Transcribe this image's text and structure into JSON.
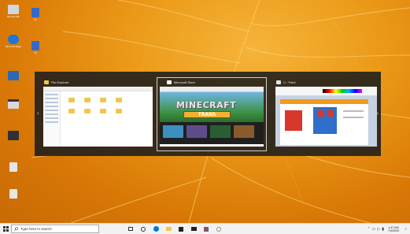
{
  "desktop": {
    "icons": [
      {
        "label": "Recycle Bin",
        "color": "#cfd7e3"
      },
      {
        "label": "Microsoft Edge",
        "color": "#1e77d3"
      },
      {
        "label": "",
        "color": "#2c69b5"
      },
      {
        "label": "",
        "color": "#d9d9d9"
      },
      {
        "label": "",
        "color": "#2f3138"
      },
      {
        "label": "",
        "color": "#e7e7e7"
      },
      {
        "label": "",
        "color": "#e7e7e7"
      }
    ],
    "icons_col2": [
      {
        "label": "W",
        "color": "#3569c8"
      },
      {
        "label": "W",
        "color": "#3569c8"
      }
    ]
  },
  "switcher": {
    "windows": [
      {
        "title": "File Explorer",
        "icon": "folder-icon",
        "selected": false
      },
      {
        "title": "Microsoft Store",
        "icon": "store-icon",
        "selected": true
      },
      {
        "title": "U - Paint",
        "icon": "paint-icon",
        "selected": false
      }
    ],
    "store": {
      "logo": "MINECRAFT",
      "subtitle": "TRANS"
    }
  },
  "taskbar": {
    "search_placeholder": "Type here to search",
    "clock_time": "1:47 AM",
    "clock_date": "7/4/2020",
    "pinned": [
      "task-view-icon",
      "cortana-icon",
      "edge-icon",
      "file-explorer-icon",
      "store-icon",
      "mail-icon",
      "paint-icon",
      "settings-icon"
    ],
    "colors": {
      "bar": "#f2f2f2",
      "accent": "#0078d7"
    }
  }
}
